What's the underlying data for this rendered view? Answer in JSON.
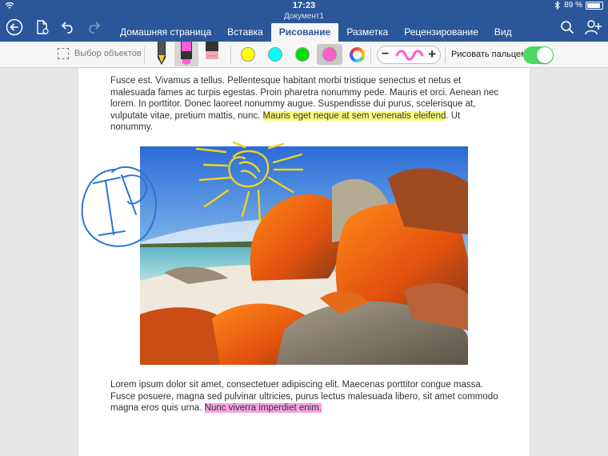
{
  "status_bar": {
    "time": "17:23",
    "battery": "89 %",
    "battery_level": 0.89
  },
  "document": {
    "title": "Документ1"
  },
  "tabs": [
    {
      "label": "Домашняя страница",
      "active": false
    },
    {
      "label": "Вставка",
      "active": false
    },
    {
      "label": "Рисование",
      "active": true
    },
    {
      "label": "Разметка",
      "active": false
    },
    {
      "label": "Рецензирование",
      "active": false
    },
    {
      "label": "Вид",
      "active": false
    }
  ],
  "icons": {
    "back": "back-arrow-circle-icon",
    "file": "document-menu-icon",
    "undo": "undo-icon",
    "redo": "redo-icon",
    "search": "search-icon",
    "share": "add-person-icon"
  },
  "ribbon": {
    "select_objects_label": "Выбор объектов",
    "pens": [
      {
        "name": "pen",
        "color": "#f2d21a"
      },
      {
        "name": "highlighter",
        "color": "#ff5ed7"
      },
      {
        "name": "eraser",
        "color": "#f5a6b5"
      }
    ],
    "selected_pen": "highlighter",
    "colors": [
      "#ffff00",
      "#00ffff",
      "#00e000",
      "#ff5ec7"
    ],
    "selected_color": "#ff5ec7",
    "draw_with_finger_label": "Рисовать пальцем",
    "draw_with_finger": true
  },
  "body": {
    "p1": "Fusce est. Vivamus a tellus. Pellentesque habitant morbi tristique senectus et netus et malesuada fames ac turpis egestas. Proin pharetra nonummy pede. Mauris et orci. Aenean nec lorem. In porttitor. Donec laoreet nonummy augue. Suspendisse dui purus, scelerisque at, vulputate vitae, pretium mattis, nunc.",
    "p1_highlight": "Mauris eget neque at sem venenatis eleifend",
    "p1_end": ". Ut nonummy.",
    "p2": "Lorem ipsum dolor sit amet, consectetuer adipiscing elit. Maecenas porttitor congue massa. Fusce posuere, magna sed pulvinar ultricies, purus lectus malesuada libero, sit amet commodo magna eros quis urna.",
    "p2_highlight": "Nunc viverra imperdiet enim."
  },
  "ink_annotation": {
    "initials": "IP"
  },
  "accent_colors": {
    "ribbon_blue": "#2b579a",
    "toggle_green": "#4cd964",
    "ink_blue": "#2a75d6",
    "ink_yellow": "#f2d21a"
  }
}
